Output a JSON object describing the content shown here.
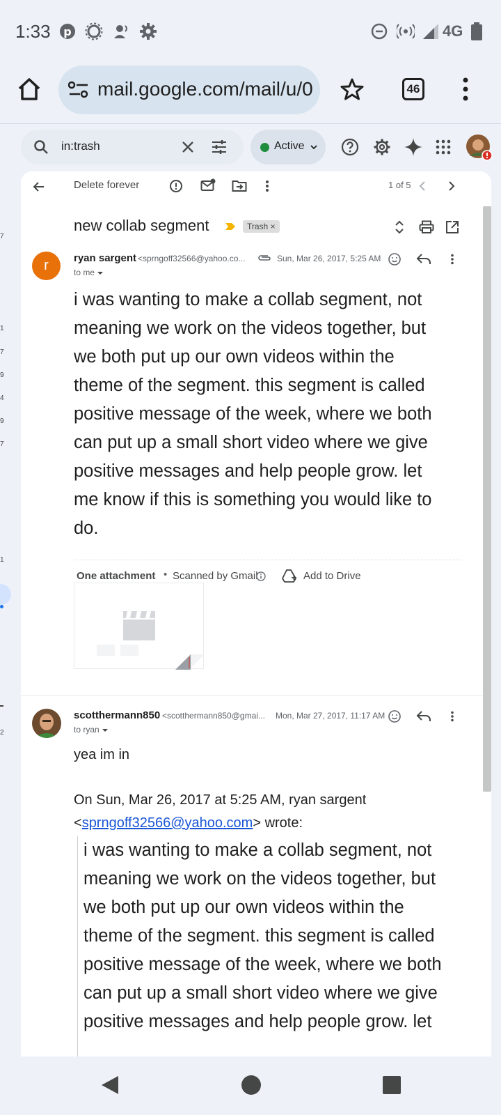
{
  "status_bar": {
    "time": "1:33",
    "network": "4G",
    "icons": [
      "pinterest-icon",
      "settings-sun-icon",
      "voice-icon",
      "settings-gear-icon",
      "dnd-icon",
      "hotspot-icon",
      "signal-icon",
      "battery-icon"
    ]
  },
  "browser": {
    "url": "mail.google.com/mail/u/0",
    "tab_count": "46"
  },
  "search": {
    "query": "in:trash"
  },
  "status_button": {
    "label": "Active",
    "color": "#1e8e3e"
  },
  "action_bar": {
    "delete_forever": "Delete forever",
    "pagination": "1 of 5"
  },
  "thread": {
    "subject": "new collab segment",
    "label_chip": "Trash",
    "label_chip_close": "×"
  },
  "message1": {
    "avatar_letter": "r",
    "avatar_color": "#e8710a",
    "sender_name": "ryan sargent",
    "sender_email": "<sprngoff32566@yahoo.co...",
    "date": "Sun, Mar 26, 2017, 5:25 AM",
    "to": "to me",
    "body_lines": [
      "i was wanting to make a collab segment, not",
      "meaning we work on the videos together, but",
      "we both put up our own videos within the",
      "theme of the segment. this segment is called",
      "positive message of the week, where we both",
      "can put up a small short video where we give",
      "positive messages and help people grow. let",
      "me know if this is something you would like to",
      "do."
    ],
    "attachment_label": "One attachment",
    "scanned_label": "Scanned by Gmail",
    "add_to_drive": "Add to Drive"
  },
  "message2": {
    "sender_name": "scotthermann850",
    "sender_email": "<scotthermann850@gmai...",
    "date": "Mon, Mar 27, 2017, 11:17 AM",
    "to": "to ryan",
    "reply": "yea im in",
    "quote_intro": "On Sun, Mar 26, 2017 at 5:25 AM, ryan sargent",
    "quote_lt": "<",
    "quote_email": "sprngoff32566@yahoo.com",
    "quote_wrote": "> wrote:",
    "quote_lines": [
      "i was wanting to make a collab segment, not",
      "meaning we work on the videos together, but",
      "we both put up our own videos within the",
      "theme of the segment. this segment is called",
      "positive message of the week, where we both",
      "can put up a small short video where we give",
      "positive messages and help people grow. let"
    ]
  },
  "left_edge_numbers": [
    "7",
    "1",
    "7",
    "9",
    "4",
    "9",
    "7",
    "1",
    "2"
  ]
}
